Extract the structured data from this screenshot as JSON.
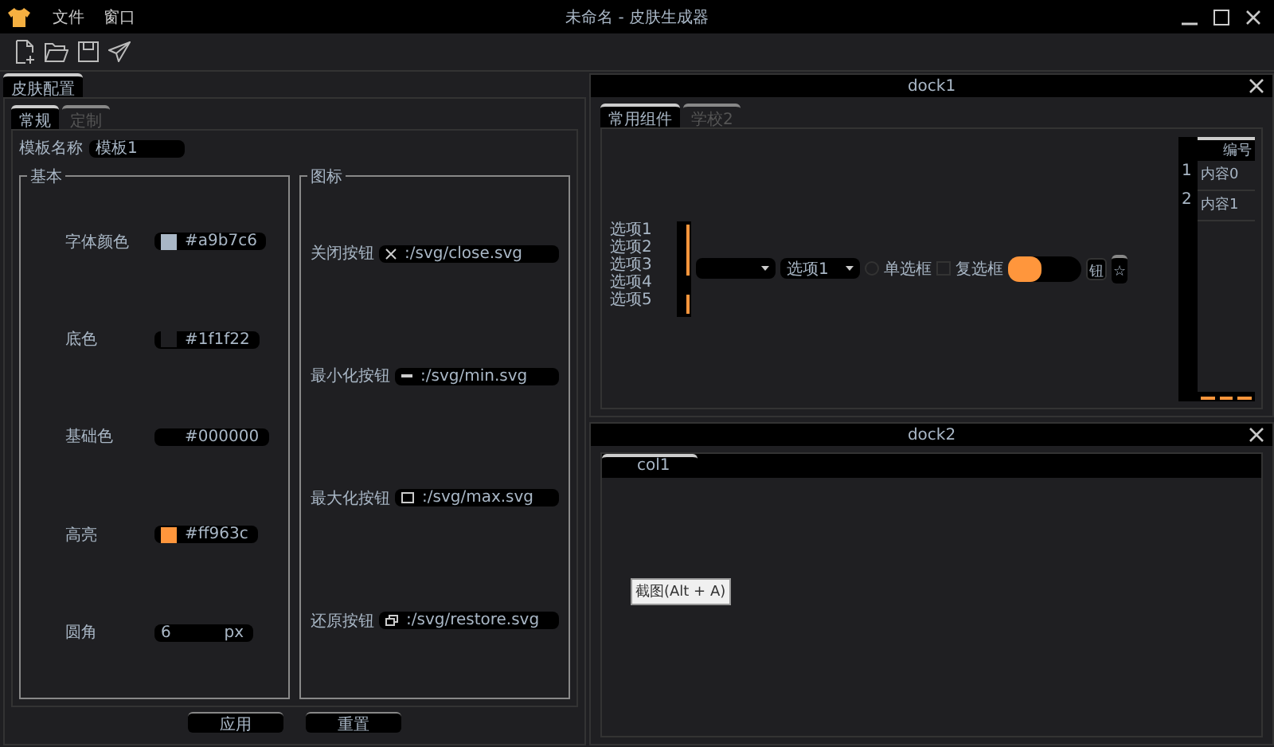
{
  "window": {
    "title": "未命名 - 皮肤生成器"
  },
  "menu": [
    "文件",
    "窗口"
  ],
  "outer_tabs": [
    {
      "label": "皮肤配置",
      "selected": true
    }
  ],
  "inner_tabs": [
    {
      "label": "常规",
      "selected": true
    },
    {
      "label": "定制",
      "selected": false
    }
  ],
  "template": {
    "label": "模板名称",
    "value": "模板1"
  },
  "basic": {
    "title": "基本",
    "rows": [
      {
        "kind": "color",
        "label": "字体颜色",
        "value": "#a9b7c6",
        "color": "#a9b7c6"
      },
      {
        "kind": "color",
        "label": "底色",
        "value": "#1f1f22",
        "color": "#1f1f22"
      },
      {
        "kind": "color",
        "label": "基础色",
        "value": "#000000"
      },
      {
        "kind": "color",
        "label": "高亮",
        "value": "#ff963c",
        "color": "#ff963c"
      },
      {
        "kind": "number",
        "label": "圆角",
        "value": "6",
        "unit": "px"
      }
    ]
  },
  "icons": {
    "title": "图标",
    "rows": [
      {
        "kind": "close",
        "label": "关闭按钮",
        "value": ":/svg/close.svg"
      },
      {
        "kind": "min",
        "label": "最小化按钮",
        "value": ":/svg/min.svg"
      },
      {
        "kind": "max",
        "label": "最大化按钮",
        "value": ":/svg/max.svg"
      },
      {
        "kind": "restore",
        "label": "还原按钮",
        "value": ":/svg/restore.svg"
      }
    ]
  },
  "buttons": [
    "应用",
    "重置"
  ],
  "dock1": {
    "title": "dock1",
    "tabs": [
      {
        "label": "常用组件",
        "selected": true
      },
      {
        "label": "学校2",
        "selected": false
      }
    ],
    "list": [
      "选项1",
      "选项2",
      "选项3",
      "选项4",
      "选项5"
    ],
    "combos": [
      {
        "kind": "blank"
      },
      {
        "kind": "text",
        "value": "选项1"
      }
    ],
    "radio": {
      "label": "单选框",
      "checked": false
    },
    "checkbox": {
      "label": "复选框",
      "checked": false
    },
    "slider": {
      "level": 0.45
    },
    "button": "钮",
    "star_button": "☆",
    "table": {
      "columns": [
        "编号"
      ],
      "rows": [
        {
          "number": "1",
          "cell": "内容0"
        },
        {
          "number": "2",
          "cell": "内容1"
        }
      ]
    }
  },
  "dock2": {
    "title": "dock2",
    "columns": [
      "col1"
    ],
    "tooltip": "截图(Alt + A)"
  }
}
